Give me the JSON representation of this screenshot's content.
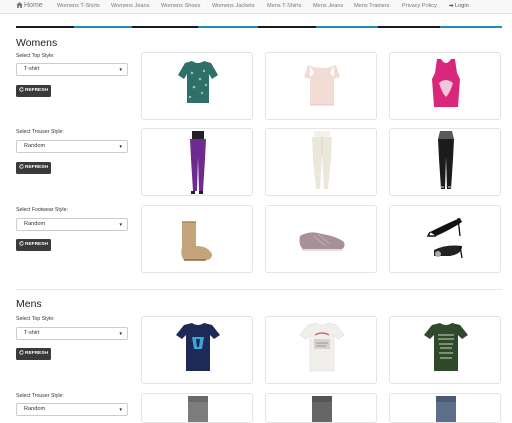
{
  "nav": {
    "home": "Home",
    "items": [
      "Womens T-Shirts",
      "Womens Jeans",
      "Womens Shoes",
      "Womens Jackets",
      "Mens T-Shirts",
      "Mens Jeans",
      "Mens Trainers",
      "Privacy Policy"
    ],
    "login": "Login"
  },
  "womens": {
    "title": "Womens",
    "top_label": "Select Top Style:",
    "top_value": "T-shirt",
    "trouser_label": "Select Trouser Style:",
    "trouser_value": "Random",
    "footwear_label": "Select Footwear Style:",
    "footwear_value": "Random",
    "refresh": "REFRESH"
  },
  "mens": {
    "title": "Mens",
    "top_label": "Select Top Style:",
    "top_value": "T-shirt",
    "trouser_label": "Select Trouser Style:",
    "trouser_value": "Random",
    "refresh": "REFRESH"
  },
  "colors": {
    "stripe_dark": "#1a1a1a",
    "stripe_blue": "#1f8dc0",
    "button": "#3a3a3a"
  }
}
